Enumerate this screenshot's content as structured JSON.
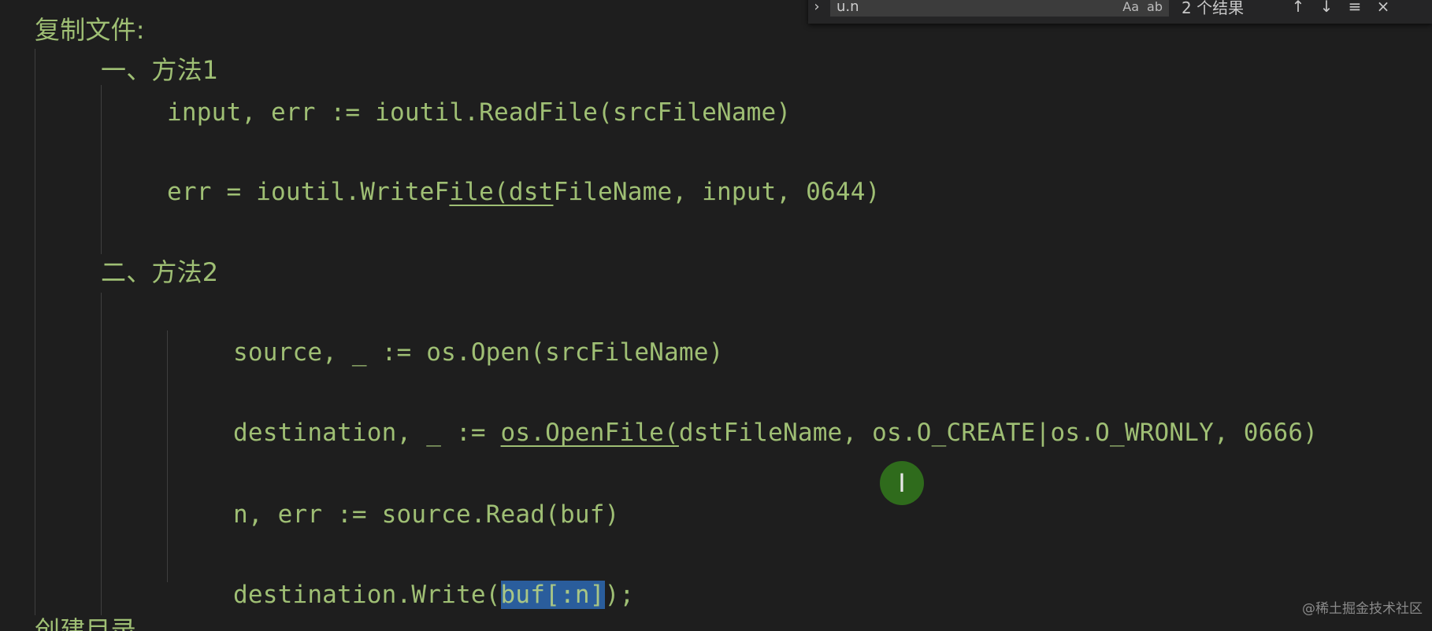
{
  "find_widget": {
    "query": "u.n",
    "option_case": "Aa",
    "option_word": "ab",
    "result_count": "2 个结果",
    "prev_label": "↑",
    "next_label": "↓",
    "selection_label": "≡",
    "close_label": "×",
    "toggle_label": "›"
  },
  "document": {
    "heading": "复制文件:",
    "method1_heading": "一、方法1",
    "method1_line1": "input, err := ioutil.ReadFile(srcFileName)",
    "method1_line2_pre": "err = ioutil.WriteF",
    "method1_line2_ul": "ile(dst",
    "method1_line2_post": "FileName, input, 0644)",
    "method2_heading": "二、方法2",
    "method2_line1": "source, _ := os.Open(srcFileName)",
    "method2_line2_pre": "destination, _ := ",
    "method2_line2_ul": "os.OpenFile(",
    "method2_line2_post": "dstFileName, os.O_CREATE|os.O_WRONLY, 0666)",
    "method2_line3": "n, err := source.Read(buf)",
    "method2_line4_pre": "destination.Write(",
    "method2_line4_sel": "buf[:n]",
    "method2_line4_post": ");",
    "next_heading": "创建目录"
  },
  "cursor": {
    "glyph": "I"
  },
  "watermark": "@稀土掘金技术社区",
  "colors": {
    "background": "#1e1e1e",
    "text": "#9fbf74",
    "selection": "#2a5d9c",
    "cursor_highlight": "#2f6b1c"
  }
}
